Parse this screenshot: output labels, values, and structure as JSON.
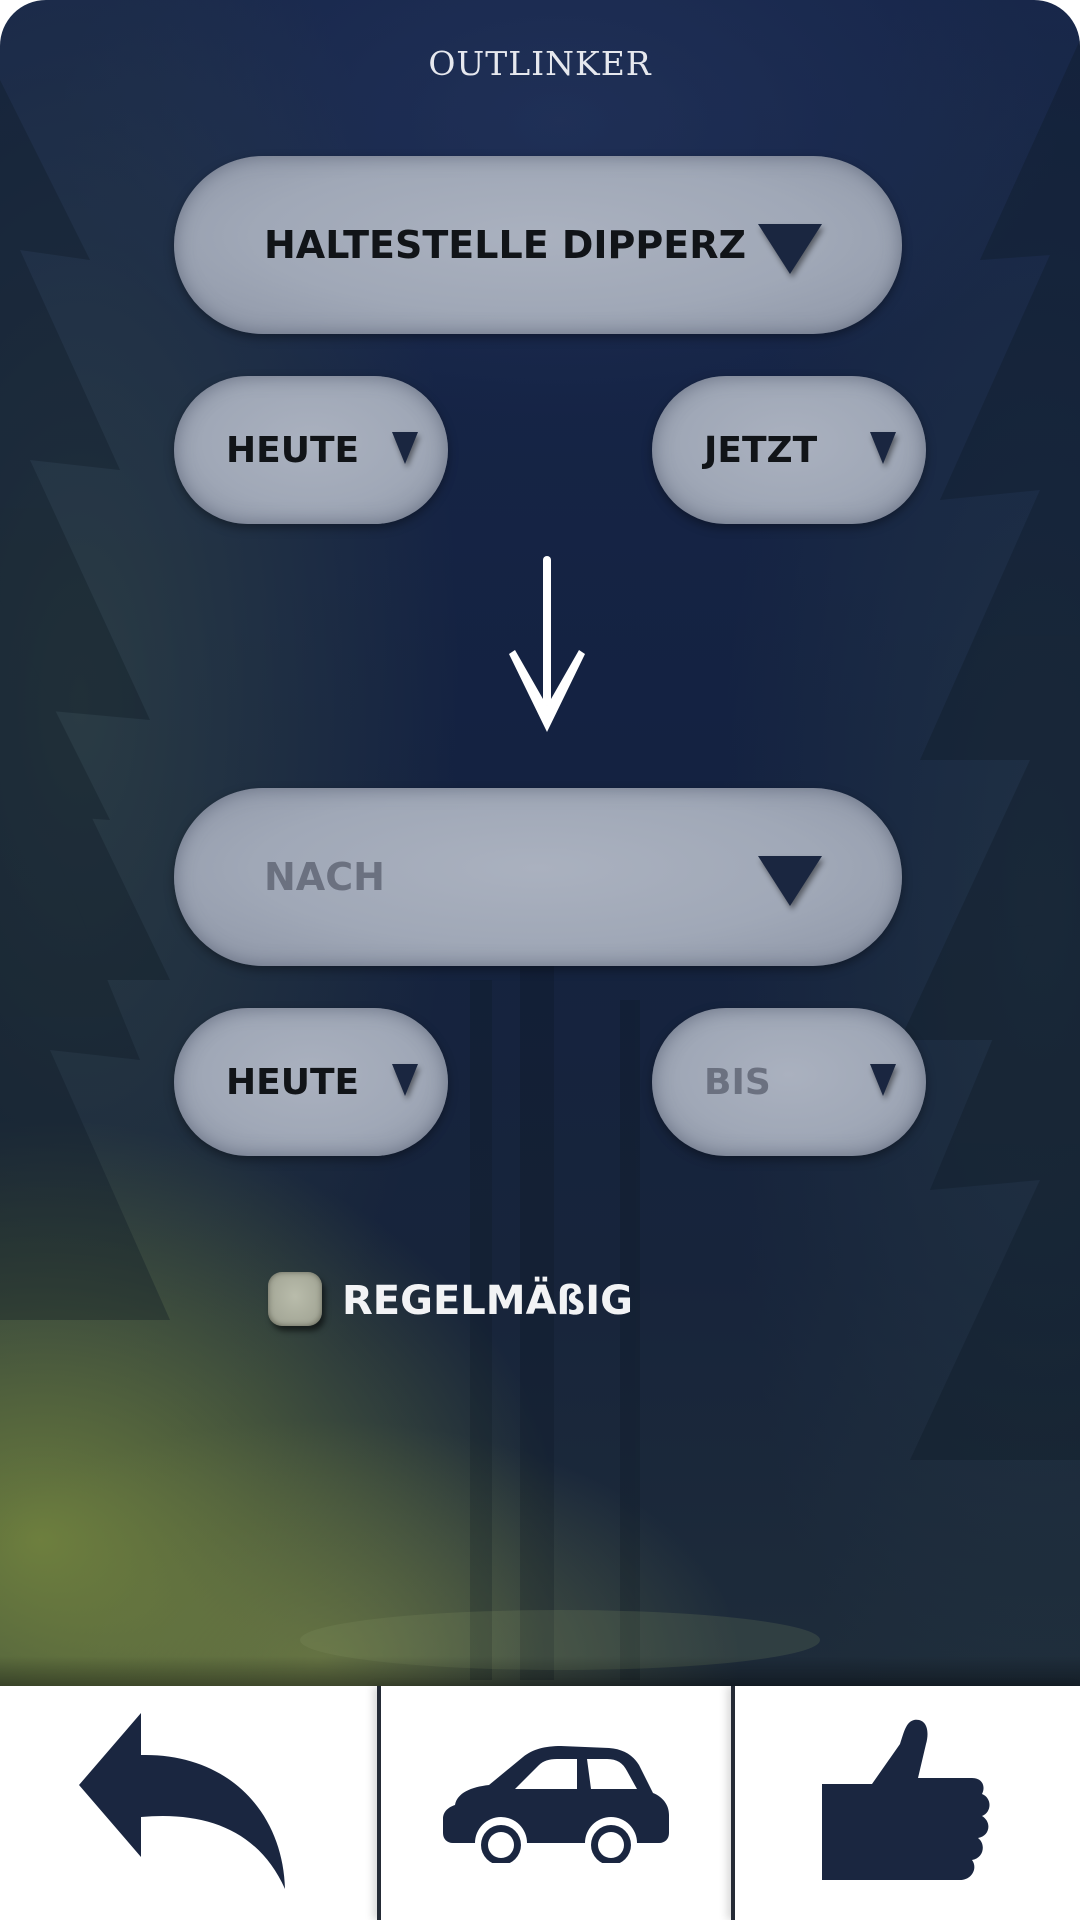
{
  "app": {
    "title": "OUTLINKER"
  },
  "from": {
    "stop": "HALTESTELLE DIPPERZ",
    "date": "HEUTE",
    "time": "JETZT"
  },
  "to": {
    "stop_placeholder": "NACH",
    "date": "HEUTE",
    "time_placeholder": "BIS"
  },
  "recurring": {
    "label": "REGELMÄßIG",
    "checked": false
  },
  "nav": {
    "items": [
      {
        "icon": "back-arrow-icon"
      },
      {
        "icon": "car-icon"
      },
      {
        "icon": "thumbs-up-icon"
      }
    ]
  },
  "colors": {
    "primary": "#1a2640",
    "pill": "#a0a8b7",
    "nav_background": "#ffffff"
  }
}
